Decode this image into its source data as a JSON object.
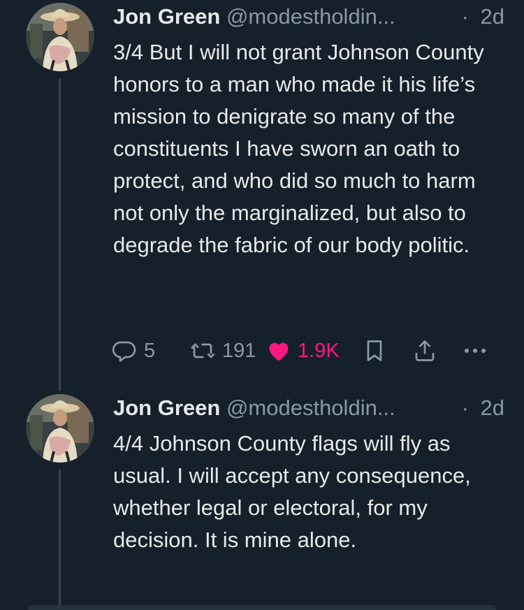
{
  "tweets": [
    {
      "author_name": "Jon Green",
      "handle": "@modestholdin...",
      "dot": "·",
      "time": "2d",
      "text": "3/4 But I will not grant Johnson County honors to a man who made it his life’s mission to denigrate so many of the constituents I have sworn an oath to protect, and who did so much to harm not only the marginalized, but also to degrade the fabric of our body politic.",
      "reply_count": "5",
      "retweet_count": "191",
      "like_count": "1.9K",
      "liked": true,
      "icons": {
        "reply": "reply-icon",
        "retweet": "retweet-icon",
        "like": "heart-icon",
        "bookmark": "bookmark-icon",
        "share": "share-icon",
        "more": "more-icon"
      },
      "colors": {
        "like": "#f91880"
      }
    },
    {
      "author_name": "Jon Green",
      "handle": "@modestholdin...",
      "dot": "·",
      "time": "2d",
      "text": "4/4 Johnson County flags will fly as usual. I will accept any consequence, whether legal or electoral, for my decision. It is mine alone."
    }
  ],
  "colors": {
    "background": "#15202b",
    "text": "#e7e9ea",
    "muted": "#8b98a5",
    "thread_line": "#38444d"
  }
}
